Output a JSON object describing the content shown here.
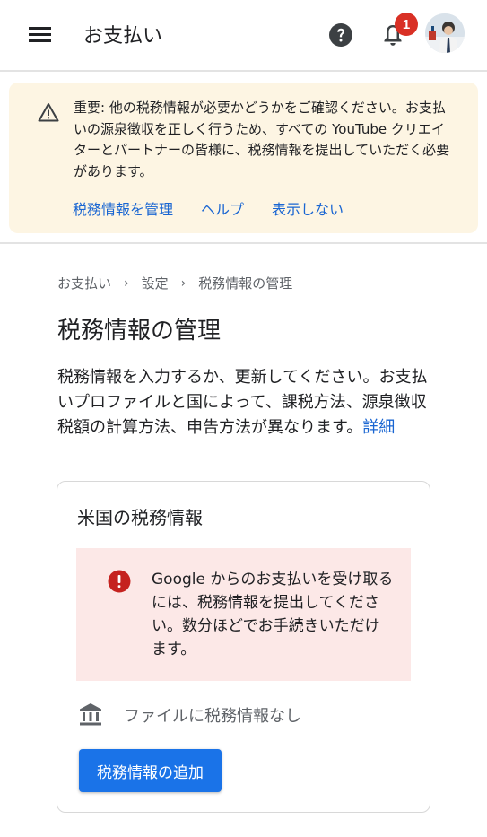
{
  "header": {
    "title": "お支払い",
    "notification_count": "1",
    "icons": [
      "menu-icon",
      "help-icon",
      "bell-icon",
      "avatar"
    ]
  },
  "banner": {
    "text": "重要: 他の税務情報が必要かどうかをご確認ください。お支払いの源泉徴収を正しく行うため、すべての YouTube クリエイターとパートナーの皆様に、税務情報を提出していただく必要があります。",
    "actions": {
      "manage": "税務情報を管理",
      "help": "ヘルプ",
      "dismiss": "表示しない"
    }
  },
  "breadcrumb": {
    "items": [
      "お支払い",
      "設定",
      "税務情報の管理"
    ],
    "separator": "›"
  },
  "page": {
    "title": "税務情報の管理",
    "description": "税務情報を入力するか、更新してください。お支払いプロファイルと国によって、課税方法、源泉徴収税額の計算方法、申告方法が異なります。",
    "details_link": "詳細"
  },
  "card": {
    "title": "米国の税務情報",
    "alert": "Google からのお支払いを受け取るには、税務情報を提出してください。数分ほどでお手続きいただけます。",
    "no_info": "ファイルに税務情報なし",
    "add_button": "税務情報の追加"
  },
  "colors": {
    "link": "#1a66d2",
    "banner_bg": "#fdf5e3",
    "alert_bg": "#fce8e7",
    "error_red": "#d93025",
    "button": "#1a73e8"
  }
}
